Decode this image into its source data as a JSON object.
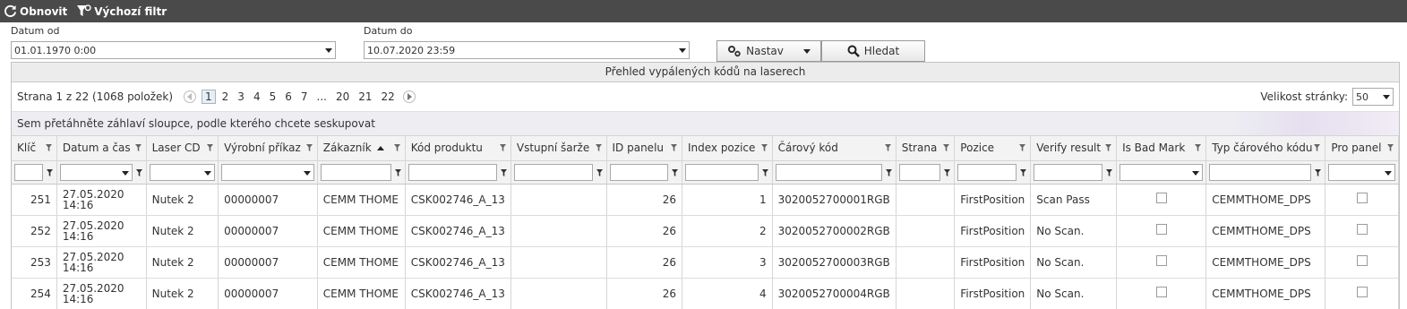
{
  "toolbar": {
    "refresh_label": "Obnovit",
    "default_filter_label": "Výchozí filtr"
  },
  "filters": {
    "date_from_label": "Datum od",
    "date_from_value": "01.01.1970 0:00",
    "date_to_label": "Datum do",
    "date_to_value": "10.07.2020 23:59",
    "settings_label": "Nastav",
    "search_label": "Hledat"
  },
  "grid": {
    "caption": "Přehled vypálených kódů na laserech",
    "pager_info": "Strana 1 z 22 (1068 položek)",
    "pages": [
      "1",
      "2",
      "3",
      "4",
      "5",
      "6",
      "7",
      "...",
      "20",
      "21",
      "22"
    ],
    "page_size_label": "Velikost stránky:",
    "page_size_value": "50",
    "group_hint": "Sem přetáhněte záhlaví sloupce, podle kterého chcete seskupovat",
    "columns": [
      "Klíč",
      "Datum a čas",
      "Laser CD",
      "Výrobní příkaz",
      "Zákazník",
      "Kód produktu",
      "Vstupní šarže",
      "ID panelu",
      "Index pozice",
      "Čárový kód",
      "Strana",
      "Pozice",
      "Verify result",
      "Is Bad Mark",
      "Typ čárového kódu",
      "Pro panel"
    ],
    "rows": [
      {
        "key": "251",
        "date": "27.05.2020",
        "time": "14:16",
        "laser": "Nutek 2",
        "order": "00000007",
        "customer": "CEMM THOME",
        "product": "CSK002746_A_13",
        "batch": "",
        "panel_id": "26",
        "pos_index": "1",
        "barcode": "3020052700001RGB",
        "side": "",
        "position": "FirstPosition",
        "verify": "Scan Pass",
        "code_type": "CEMMTHOME_DPS"
      },
      {
        "key": "252",
        "date": "27.05.2020",
        "time": "14:16",
        "laser": "Nutek 2",
        "order": "00000007",
        "customer": "CEMM THOME",
        "product": "CSK002746_A_13",
        "batch": "",
        "panel_id": "26",
        "pos_index": "2",
        "barcode": "3020052700002RGB",
        "side": "",
        "position": "FirstPosition",
        "verify": "No Scan.",
        "code_type": "CEMMTHOME_DPS"
      },
      {
        "key": "253",
        "date": "27.05.2020",
        "time": "14:16",
        "laser": "Nutek 2",
        "order": "00000007",
        "customer": "CEMM THOME",
        "product": "CSK002746_A_13",
        "batch": "",
        "panel_id": "26",
        "pos_index": "3",
        "barcode": "3020052700003RGB",
        "side": "",
        "position": "FirstPosition",
        "verify": "No Scan.",
        "code_type": "CEMMTHOME_DPS"
      },
      {
        "key": "254",
        "date": "27.05.2020",
        "time": "14:16",
        "laser": "Nutek 2",
        "order": "00000007",
        "customer": "CEMM THOME",
        "product": "CSK002746_A_13",
        "batch": "",
        "panel_id": "26",
        "pos_index": "4",
        "barcode": "3020052700004RGB",
        "side": "",
        "position": "FirstPosition",
        "verify": "No Scan.",
        "code_type": "CEMMTHOME_DPS"
      }
    ]
  }
}
